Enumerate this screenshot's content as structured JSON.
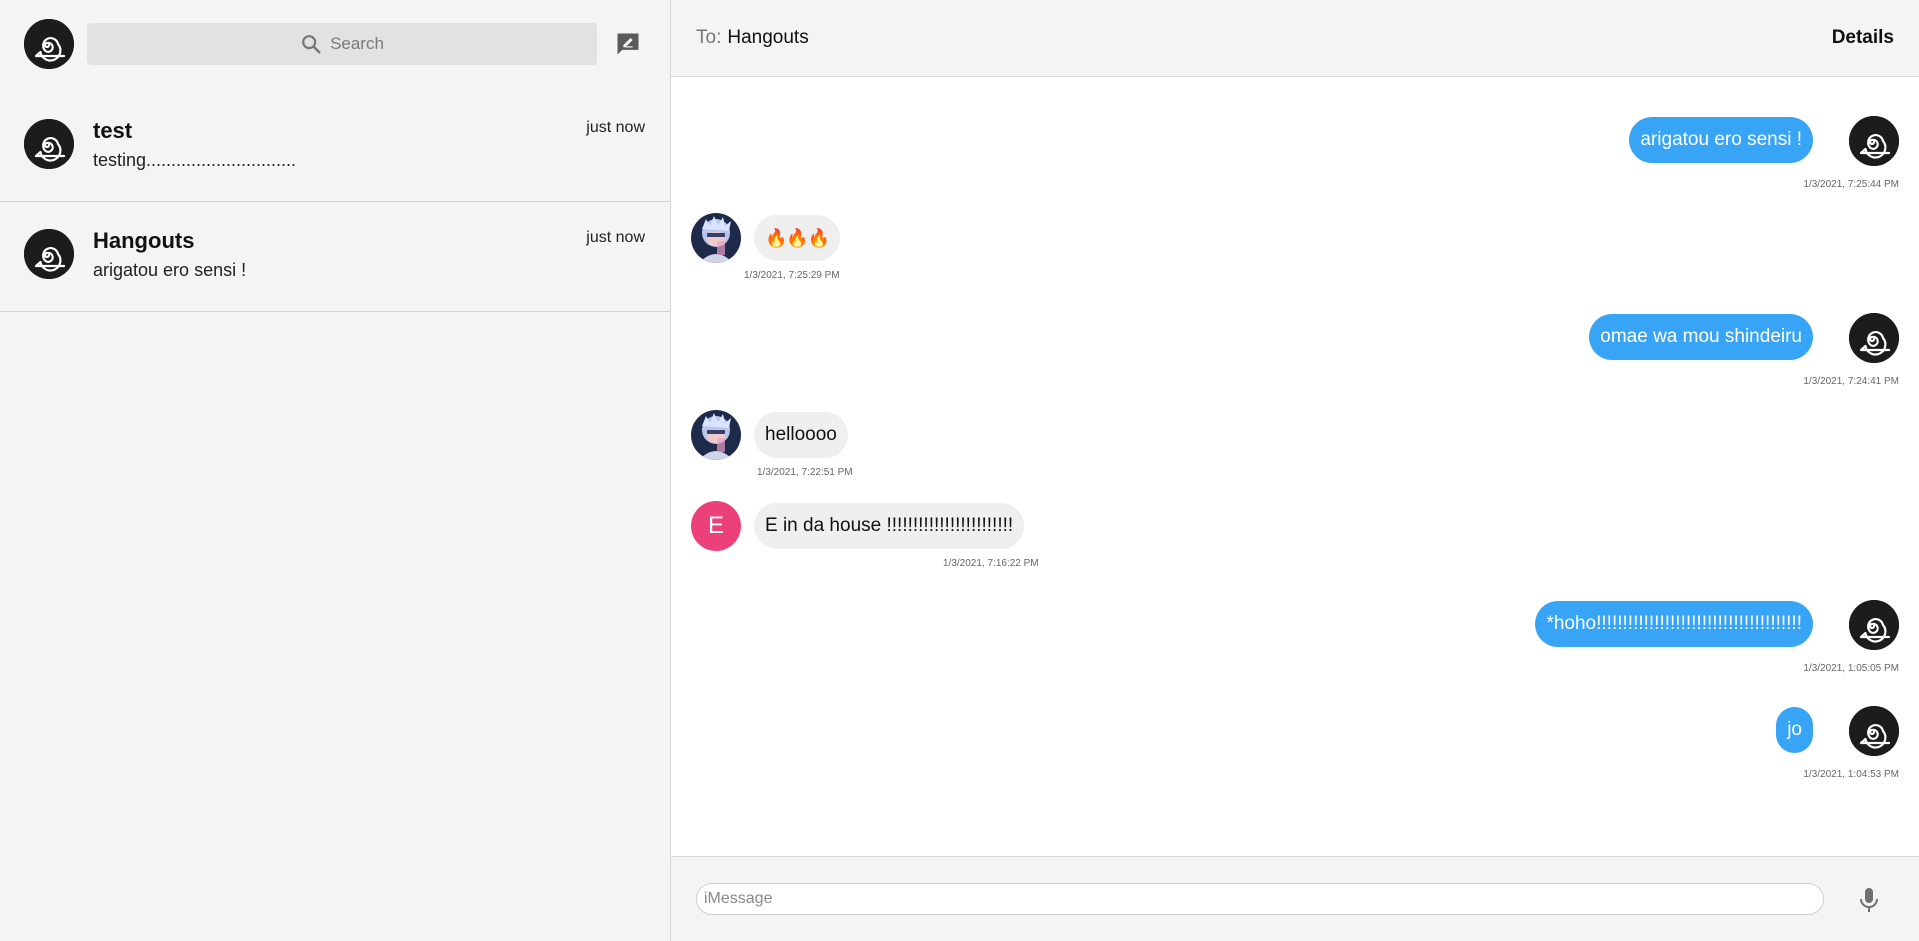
{
  "sidebar": {
    "search_placeholder": "Search",
    "chats": [
      {
        "name": "test",
        "preview": "testing..............................",
        "time": "just now"
      },
      {
        "name": "Hangouts",
        "preview": "arigatou ero sensi !",
        "time": "just now"
      }
    ]
  },
  "header": {
    "to_label": "To:",
    "to_name": "Hangouts",
    "details_label": "Details"
  },
  "messages": [
    {
      "text": "arigatou ero sensi !",
      "timestamp": "1/3/2021, 7:25:44 PM",
      "direction": "outgoing"
    },
    {
      "text": "🔥🔥🔥",
      "timestamp": "1/3/2021, 7:25:29 PM",
      "direction": "incoming"
    },
    {
      "text": "omae wa mou shindeiru",
      "timestamp": "1/3/2021, 7:24:41 PM",
      "direction": "outgoing"
    },
    {
      "text": "helloooo",
      "timestamp": "1/3/2021, 7:22:51 PM",
      "direction": "incoming"
    },
    {
      "text": "E in da house !!!!!!!!!!!!!!!!!!!!!!!!",
      "timestamp": "1/3/2021, 7:16:22 PM",
      "direction": "incoming",
      "avatar_letter": "E"
    },
    {
      "text": "*hoho!!!!!!!!!!!!!!!!!!!!!!!!!!!!!!!!!!!!!!!",
      "timestamp": "1/3/2021, 1:05:05 PM",
      "direction": "outgoing"
    },
    {
      "text": "jo",
      "timestamp": "1/3/2021, 1:04:53 PM",
      "direction": "outgoing"
    }
  ],
  "composer": {
    "placeholder": "iMessage"
  },
  "colors": {
    "outgoing_bubble": "#38a4f5",
    "incoming_bubble": "#efefef",
    "letter_avatar": "#ec407a",
    "sidebar_bg": "#f4f4f4"
  },
  "icons": [
    "leaf-village-logo-icon",
    "search-icon",
    "compose-icon",
    "microphone-icon",
    "user-photo-avatar"
  ]
}
